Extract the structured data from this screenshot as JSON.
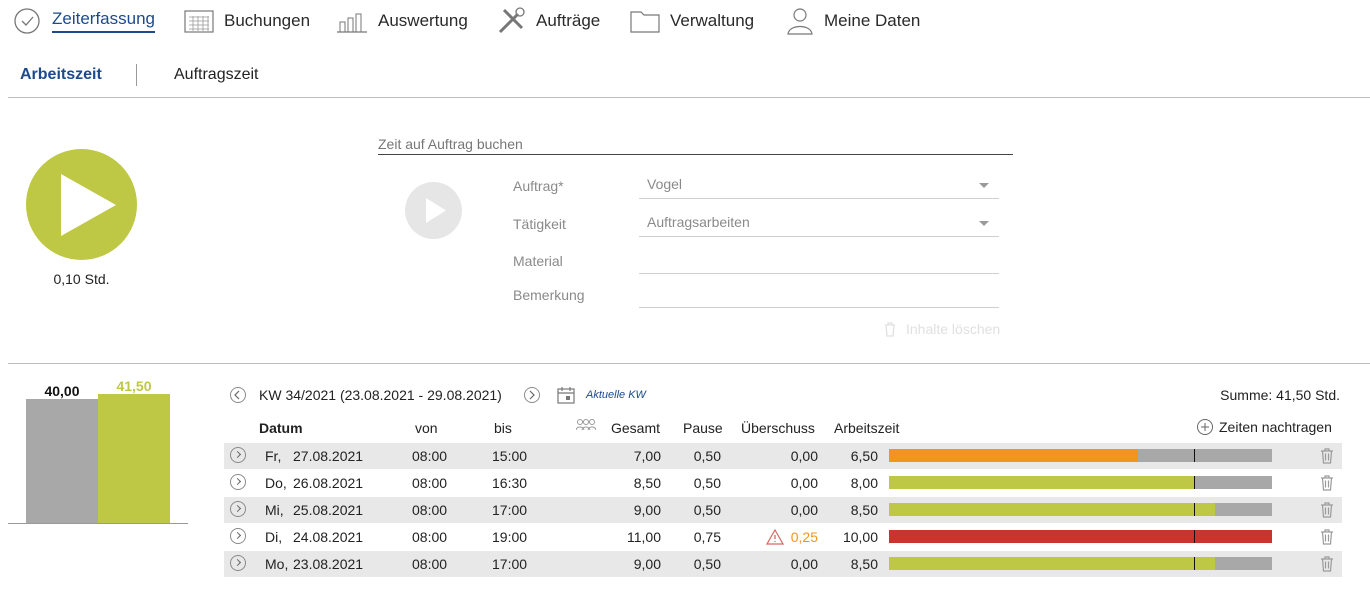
{
  "nav": [
    {
      "label": "Zeiterfassung",
      "icon": "clock-check-icon",
      "active": true
    },
    {
      "label": "Buchungen",
      "icon": "calendar-grid-icon"
    },
    {
      "label": "Auswertung",
      "icon": "bar-chart-icon"
    },
    {
      "label": "Aufträge",
      "icon": "tools-icon"
    },
    {
      "label": "Verwaltung",
      "icon": "folder-icon"
    },
    {
      "label": "Meine Daten",
      "icon": "user-icon"
    }
  ],
  "subtabs": [
    "Arbeitszeit",
    "Auftragszeit"
  ],
  "timer": {
    "value": "0,10 Std."
  },
  "form": {
    "title": "Zeit auf Auftrag buchen",
    "auftrag_label": "Auftrag*",
    "auftrag_value": "Vogel",
    "taetigkeit_label": "Tätigkeit",
    "taetigkeit_value": "Auftragsarbeiten",
    "material_label": "Material",
    "material_value": "",
    "bemerkung_label": "Bemerkung",
    "bemerkung_value": "",
    "clear_label": "Inhalte löschen"
  },
  "summary_chart": {
    "target": "40,00",
    "actual": "41,50"
  },
  "week": {
    "label": "KW 34/2021 (23.08.2021 - 29.08.2021)",
    "current_label": "Aktuelle KW",
    "sum": "Summe: 41,50 Std."
  },
  "table": {
    "headers": {
      "datum": "Datum",
      "von": "von",
      "bis": "bis",
      "gesamt": "Gesamt",
      "pause": "Pause",
      "ueberschuss": "Überschuss",
      "arbeitszeit": "Arbeitszeit",
      "add": "Zeiten nachtragen"
    },
    "rows": [
      {
        "day": "Fr,",
        "date": "27.08.2021",
        "von": "08:00",
        "bis": "15:00",
        "gesamt": "7,00",
        "pause": "0,50",
        "ueberschuss": "0,00",
        "arbeitszeit": "6,50",
        "fill": 0.65,
        "color": "#f0961e",
        "warn": false
      },
      {
        "day": "Do,",
        "date": "26.08.2021",
        "von": "08:00",
        "bis": "16:30",
        "gesamt": "8,50",
        "pause": "0,50",
        "ueberschuss": "0,00",
        "arbeitszeit": "8,00",
        "fill": 0.8,
        "color": "#bec845",
        "warn": false
      },
      {
        "day": "Mi,",
        "date": "25.08.2021",
        "von": "08:00",
        "bis": "17:00",
        "gesamt": "9,00",
        "pause": "0,50",
        "ueberschuss": "0,00",
        "arbeitszeit": "8,50",
        "fill": 0.85,
        "color": "#bec845",
        "warn": false
      },
      {
        "day": "Di,",
        "date": "24.08.2021",
        "von": "08:00",
        "bis": "19:00",
        "gesamt": "11,00",
        "pause": "0,75",
        "ueberschuss": "0,25",
        "arbeitszeit": "10,00",
        "fill": 1.0,
        "color": "#c8352c",
        "warn": true
      },
      {
        "day": "Mo,",
        "date": "23.08.2021",
        "von": "08:00",
        "bis": "17:00",
        "gesamt": "9,00",
        "pause": "0,50",
        "ueberschuss": "0,00",
        "arbeitszeit": "8,50",
        "fill": 0.85,
        "color": "#bec845",
        "warn": false
      }
    ]
  },
  "colors": {
    "accent": "#1d4a8c",
    "green": "#bec845",
    "orange": "#f0961e",
    "red": "#c8352c",
    "grey": "#a8a8a8"
  }
}
